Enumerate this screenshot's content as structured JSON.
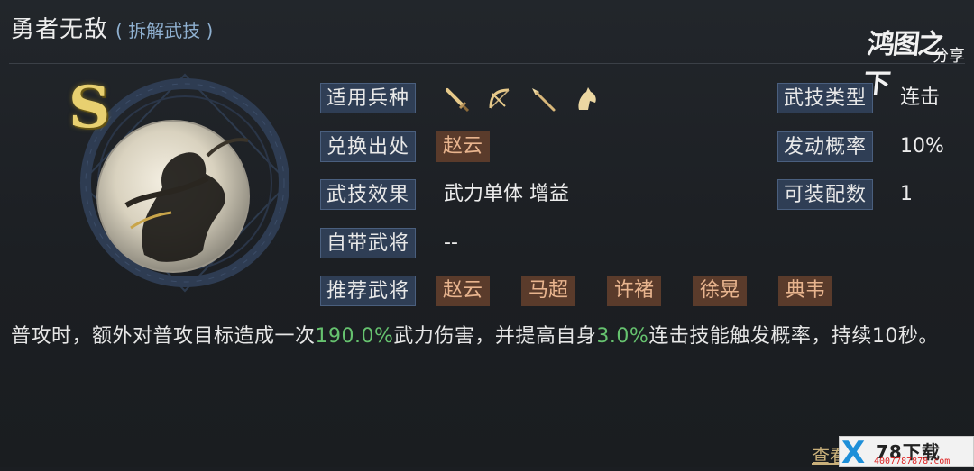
{
  "header": {
    "title": "勇者无敌",
    "subtitle": "( 拆解武技 )"
  },
  "watermark_top": {
    "main": "鸿图之下",
    "sub": "分享"
  },
  "skill": {
    "grade": "S",
    "rows": {
      "units": {
        "label": "适用兵种",
        "icons": [
          "sword-icon",
          "bow-icon",
          "spear-icon",
          "horse-icon"
        ]
      },
      "source": {
        "label": "兑换出处",
        "heroes": [
          "赵云"
        ]
      },
      "effect": {
        "label": "武技效果",
        "value": "武力单体 增益"
      },
      "own_hero": {
        "label": "自带武将",
        "value": "-- "
      },
      "recommended": {
        "label": "推荐武将",
        "heroes": [
          "赵云",
          "马超",
          "许褚",
          "徐晃",
          "典韦"
        ]
      },
      "type": {
        "label": "武技类型",
        "value": "连击"
      },
      "chance": {
        "label": "发动概率",
        "value": "10%"
      },
      "equip_count": {
        "label": "可装配数",
        "value": "1"
      }
    },
    "description": {
      "part1": "普攻时，额外对普攻目标造成一次",
      "value1": "190.0%",
      "part2": "武力伤害，并提高自身",
      "value2": "3.0%",
      "part3": "连击技能触发概率，持续10秒。"
    }
  },
  "bottom": {
    "link": "查看",
    "badge_title": "78下载",
    "badge_url": "4007787878.com"
  },
  "colors": {
    "label_bg": "#2f3e55",
    "hero_tag_bg": "#5a3b2b",
    "highlight": "#66c26f",
    "grade": "#e8d070"
  }
}
